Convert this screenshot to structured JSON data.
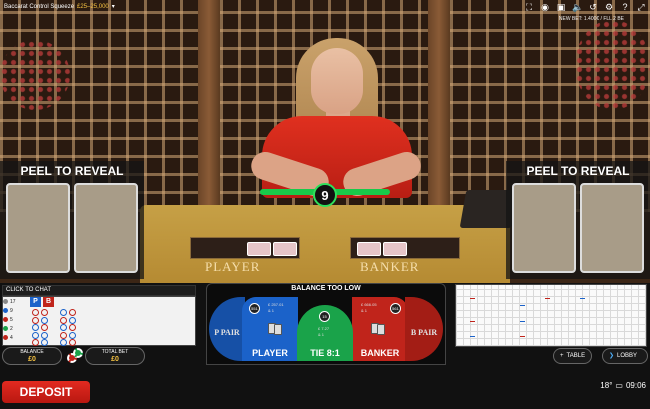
{
  "header": {
    "game_name": "Baccarat Control Squeeze",
    "limits": "£25–25,000",
    "status_line": "NEW BET: 1.400€ / FLL 2 BE"
  },
  "peel": {
    "left_title": "PEEL TO REVEAL",
    "right_title": "PEEL TO REVEAL"
  },
  "table": {
    "player_label": "PLAYER",
    "banker_label": "BANKER",
    "timer": "9"
  },
  "chat": {
    "label": "CLICK TO CHAT"
  },
  "road_small": {
    "stats": [
      "17",
      "9",
      "5",
      "2",
      "4"
    ],
    "player_head": "P",
    "banker_head": "B"
  },
  "balance": {
    "label": "BALANCE",
    "value": "£0"
  },
  "total_bet": {
    "label": "TOTAL BET",
    "value": "£0"
  },
  "betting": {
    "warning": "BALANCE TOO LOW",
    "player_pair": "P PAIR",
    "banker_pair": "B PAIR",
    "player": "PLAYER",
    "tie": "TIE 8:1",
    "banker": "BANKER",
    "player_count": "551",
    "player_total": "£ 257.01",
    "player_bets": "& 1",
    "tie_count": "15",
    "tie_total": "£ 7.27",
    "tie_bets": "& 1",
    "banker_count": "561",
    "banker_total": "£ 666.05",
    "banker_bets": "& 1"
  },
  "controls": {
    "table_button": "TABLE",
    "lobby_button": "LOBBY",
    "deposit_button": "DEPOSIT"
  },
  "status": {
    "temperature": "18°",
    "time": "09:06"
  },
  "colors": {
    "accent_gold": "#f5c242",
    "player_blue": "#1b62c9",
    "banker_red": "#c0241b",
    "tie_green": "#1aa34a",
    "deposit_red": "#e22a20"
  }
}
